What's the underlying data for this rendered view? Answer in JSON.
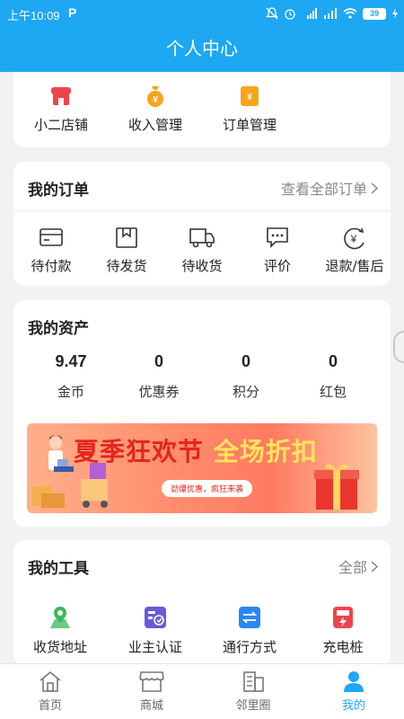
{
  "status_bar": {
    "time": "上午10:09",
    "battery": "39"
  },
  "header": {
    "title": "个人中心"
  },
  "shop_card": {
    "items": [
      {
        "label": "小二店铺",
        "icon": "shop-icon",
        "color": "#f0444c"
      },
      {
        "label": "收入管理",
        "icon": "money-bag-icon",
        "color": "#f7a51b"
      },
      {
        "label": "订单管理",
        "icon": "order-doc-icon",
        "color": "#f7a51b"
      }
    ]
  },
  "orders": {
    "title": "我的订单",
    "more": "查看全部订单",
    "items": [
      {
        "label": "待付款",
        "icon": "card-icon"
      },
      {
        "label": "待发货",
        "icon": "package-icon"
      },
      {
        "label": "待收货",
        "icon": "truck-icon"
      },
      {
        "label": "评价",
        "icon": "comment-icon"
      },
      {
        "label": "退款/售后",
        "icon": "refund-icon"
      }
    ]
  },
  "assets": {
    "title": "我的资产",
    "items": [
      {
        "value": "9.47",
        "label": "金币"
      },
      {
        "value": "0",
        "label": "优惠券"
      },
      {
        "value": "0",
        "label": "积分"
      },
      {
        "value": "0",
        "label": "红包"
      }
    ],
    "banner": {
      "headline_a": "夏季狂欢节",
      "headline_b": "全场折扣",
      "sub": "劲爆优惠，疯狂来袭"
    }
  },
  "tools": {
    "title": "我的工具",
    "more": "全部",
    "items": [
      {
        "label": "收货地址",
        "icon": "map-pin-icon",
        "color": "#3cb85c"
      },
      {
        "label": "业主认证",
        "icon": "id-card-icon",
        "color": "#6a5ad6"
      },
      {
        "label": "通行方式",
        "icon": "swap-icon",
        "color": "#2b86f2"
      },
      {
        "label": "充电桩",
        "icon": "charger-icon",
        "color": "#f0444c"
      }
    ]
  },
  "tabbar": {
    "items": [
      {
        "label": "首页",
        "icon": "home-icon"
      },
      {
        "label": "商城",
        "icon": "store-icon"
      },
      {
        "label": "邻里圈",
        "icon": "building-icon"
      },
      {
        "label": "我的",
        "icon": "user-icon"
      }
    ],
    "active_color": "#1ea7f2"
  }
}
